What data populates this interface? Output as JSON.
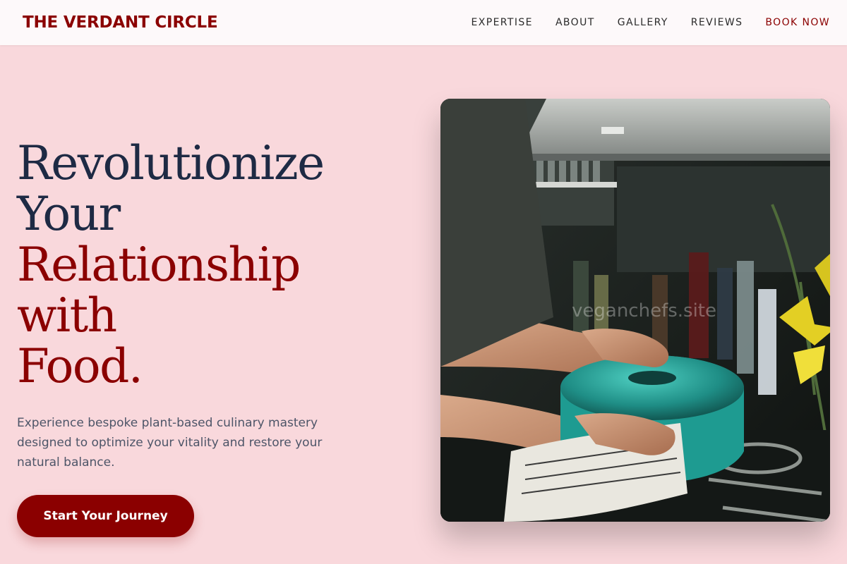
{
  "brand": {
    "name": "THE VERDANT CIRCLE",
    "primary_color": "#8b0000",
    "background_color": "#f9d8dc"
  },
  "nav": {
    "items": [
      {
        "label": "EXPERTISE"
      },
      {
        "label": "ABOUT"
      },
      {
        "label": "GALLERY"
      },
      {
        "label": "REVIEWS"
      },
      {
        "label": "BOOK NOW"
      }
    ]
  },
  "hero": {
    "headline_line1": "Revolutionize",
    "headline_line2": "Your",
    "headline_line3": "Relationship with",
    "headline_line4": "Food.",
    "subtext": "Experience bespoke plant-based culinary mastery designed to optimize your vitality and restore your natural balance.",
    "cta_label": "Start Your Journey",
    "image": {
      "watermark": "veganchefs.site"
    }
  }
}
